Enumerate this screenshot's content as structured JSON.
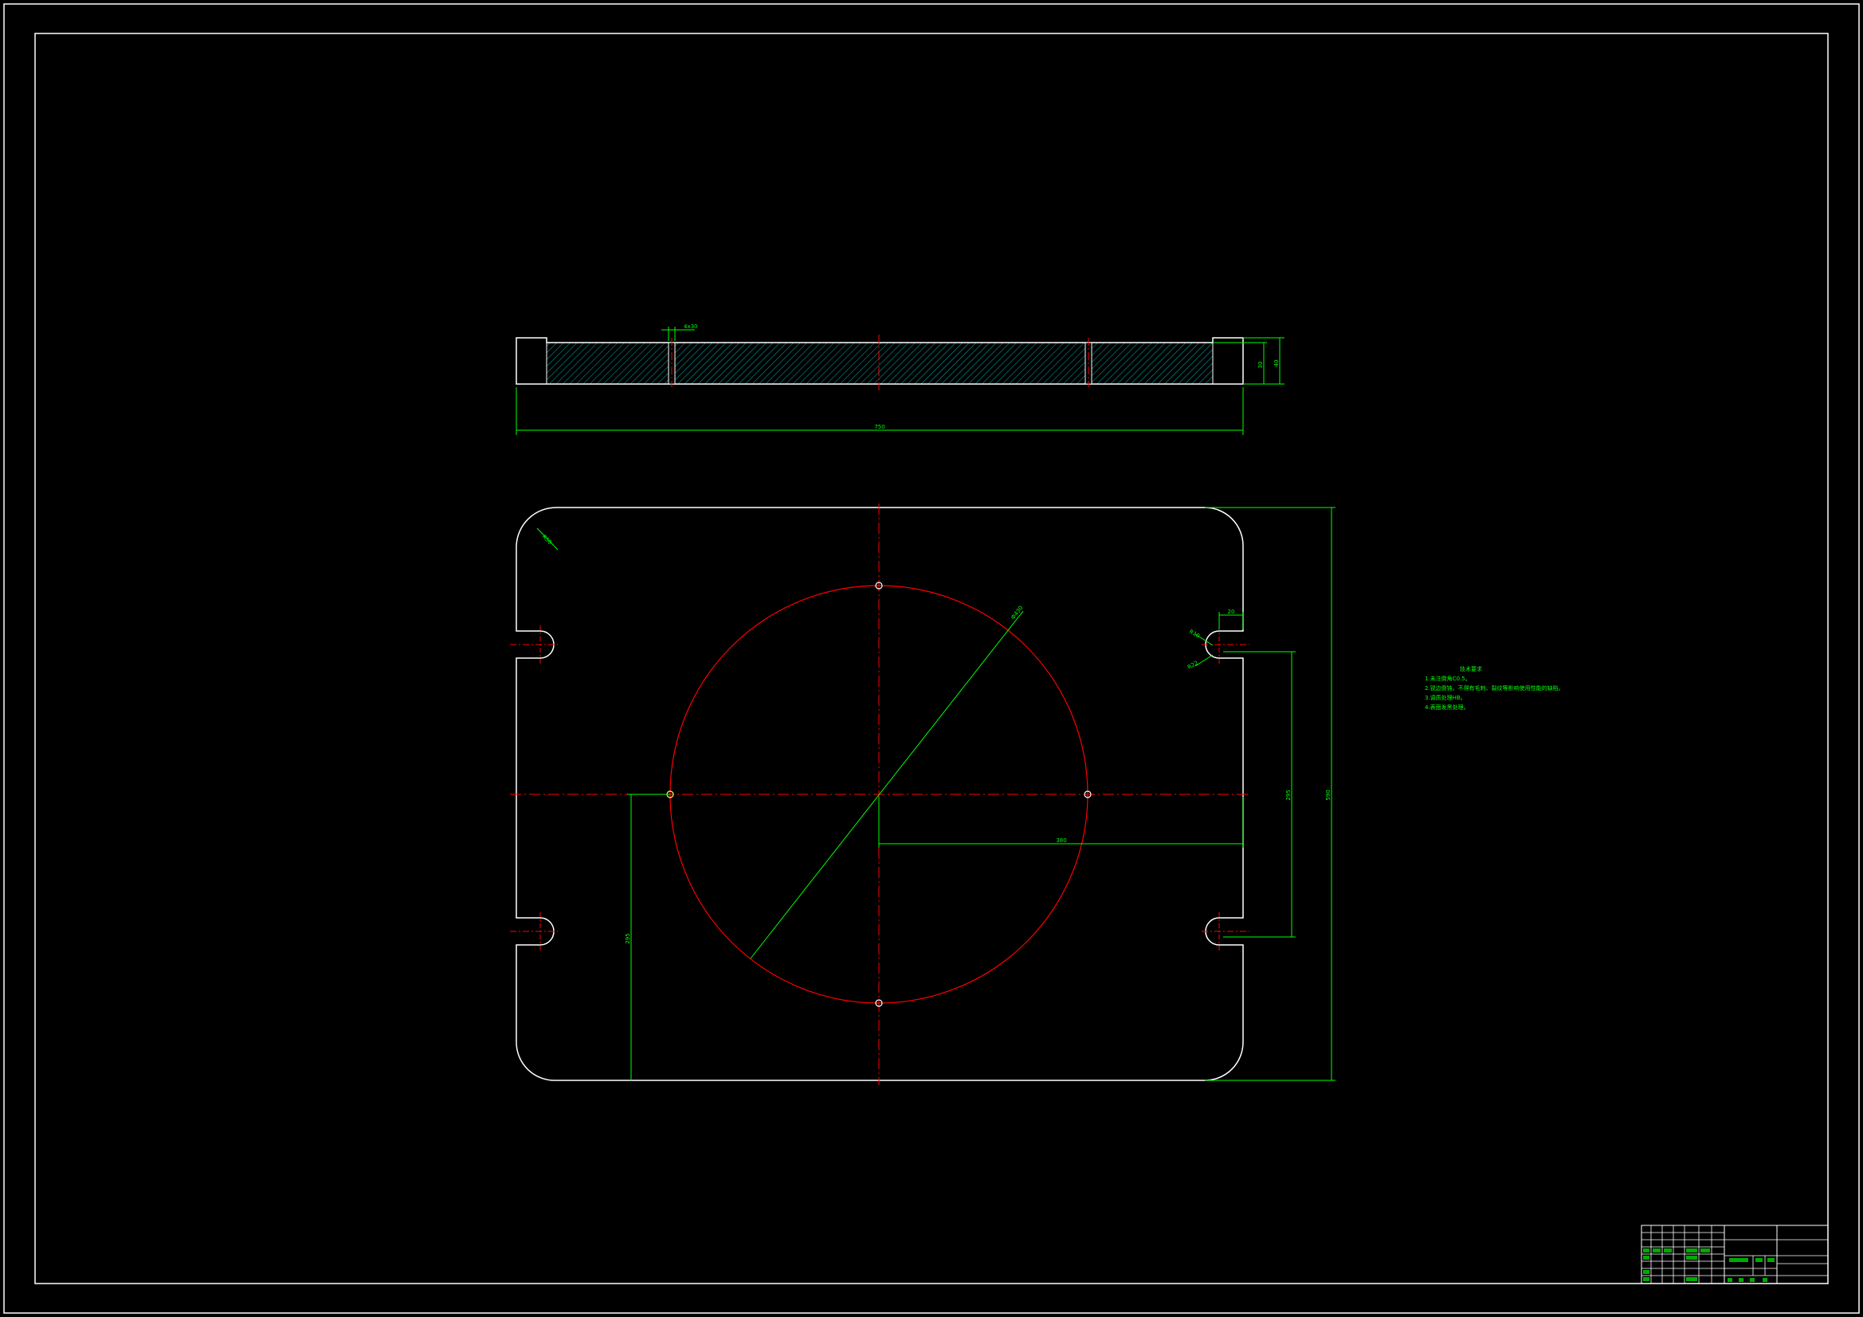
{
  "colors": {
    "background": "#000000",
    "outline": "#ffffff",
    "centerline": "#ff0000",
    "dimension": "#00ff00",
    "hatch": "#00b3b3"
  },
  "dimensions": {
    "side_width": "750",
    "side_height_total": "40",
    "side_height_inner": "30",
    "groove": "4x30",
    "plan_height": "590",
    "slot_spacing": "295",
    "circle_diameter": "Ф430",
    "hole_offset_y": "295",
    "hole_offset_x": "380",
    "corner_radius": "R50",
    "slot_width": "20",
    "slot_radius": "R10",
    "slot_depth": "R22"
  },
  "notes": {
    "title": "技术要求",
    "lines": [
      "1.未注倒角C0.5。",
      "2.锐边倒钝，不得有毛刺、裂纹等影响使用性能的缺陷。",
      "3.调质处理HB。",
      "4.表面发黑处理。"
    ]
  },
  "title_block": {
    "cells": [
      "",
      "",
      "",
      "",
      "",
      "",
      "",
      "",
      "",
      "",
      "",
      "",
      "",
      "",
      "",
      "",
      "",
      "",
      "",
      ""
    ]
  }
}
